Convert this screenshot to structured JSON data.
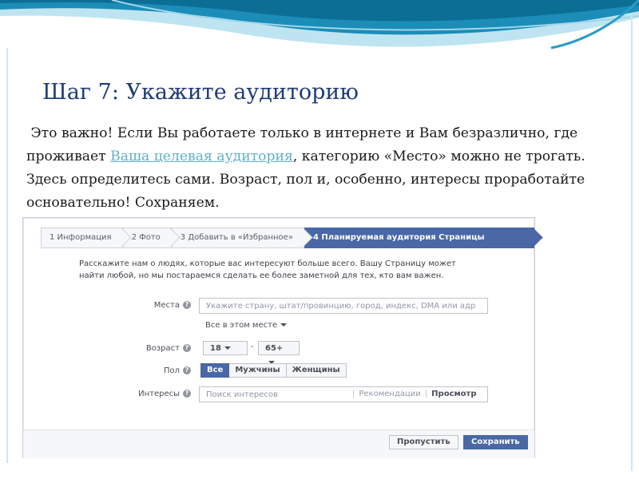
{
  "slide": {
    "title": "Шаг 7: Укажите аудиторию",
    "body_before_link": "Это важно! Если Вы работаете только в интернете и Вам безразлично, где проживает ",
    "body_link": "Ваша целевая аудитория",
    "body_after_link": ", категорию «Место» можно не трогать. Здесь определитесь сами.  Возраст, пол и, особенно, интересы проработайте основательно! Сохраняем."
  },
  "form": {
    "steps": [
      "1 Информация",
      "2 Фото",
      "3 Добавить в «Избранное»",
      "4 Планируемая аудитория Страницы"
    ],
    "active_step": 3,
    "intro": "Расскажите нам о людях, которые вас интересуют больше всего. Вашу Страницу может найти любой, но мы постараемся сделать ее более заметной для тех, кто вам важен.",
    "places_label": "Места",
    "places_placeholder": "Укажите страну, штат/провинцию, город, индекс, DMA или адр",
    "places_scope": "Все в этом месте",
    "age_label": "Возраст",
    "age_min": "18",
    "age_sep": "-",
    "age_max": "65+",
    "gender_label": "Пол",
    "gender_options": [
      "Все",
      "Мужчины",
      "Женщины"
    ],
    "gender_selected": "Все",
    "interests_label": "Интересы",
    "interests_placeholder": "Поиск интересов",
    "interests_recommendations": "Рекомендации",
    "interests_view": "Просмотр",
    "help_glyph": "?",
    "skip_button": "Пропустить",
    "save_button": "Сохранить"
  },
  "colors": {
    "title": "#1f3b76",
    "link": "#5fb0c7",
    "accent": "#4a67a6",
    "wave_dark": "#0f7fa8",
    "wave_light": "#7cc7e0"
  }
}
